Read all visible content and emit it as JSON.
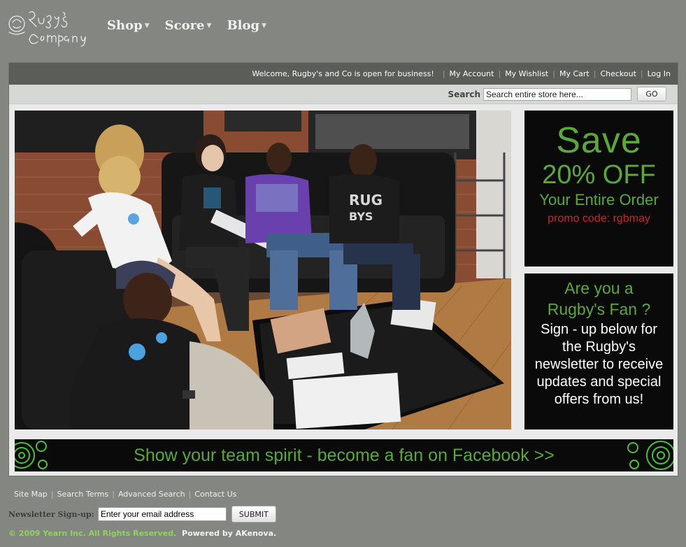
{
  "brand": {
    "logo_text": "Rugby's Company"
  },
  "topnav": [
    {
      "label": "Shop"
    },
    {
      "label": "Score"
    },
    {
      "label": "Blog"
    }
  ],
  "header_links": {
    "welcome": "Welcome, Rugby's and Co is open for business!",
    "items": [
      "My Account",
      "My Wishlist",
      "My Cart",
      "Checkout",
      "Log In"
    ]
  },
  "search": {
    "label": "Search",
    "value": "Search entire store here...",
    "button": "GO"
  },
  "promo_save": {
    "line1": "Save",
    "line2": "20% OFF",
    "line3": "Your Entire Order",
    "code": "promo code: rgbmay"
  },
  "promo_fan": {
    "q1": "Are you a",
    "q2": "Rugby's Fan ?",
    "body": "Sign - up below for the Rugby's newsletter to receive updates and special offers from us!"
  },
  "facebook_banner": {
    "text": "Show your team spirit - become a fan on Facebook >>"
  },
  "footer": {
    "links": [
      "Site Map",
      "Search Terms",
      "Advanced Search",
      "Contact Us"
    ],
    "newsletter_label": "Newsletter Sign-up:",
    "newsletter_value": "Enter your email address",
    "submit": "SUBMIT",
    "copyright": "© 2009 Yearn Inc. All Rights Reserved.",
    "powered": "Powered by AKenova."
  },
  "colors": {
    "background": "#848682",
    "accent_green": "#5aa83c",
    "promo_red": "#c0282e",
    "panel_dark": "#5b5d59"
  }
}
